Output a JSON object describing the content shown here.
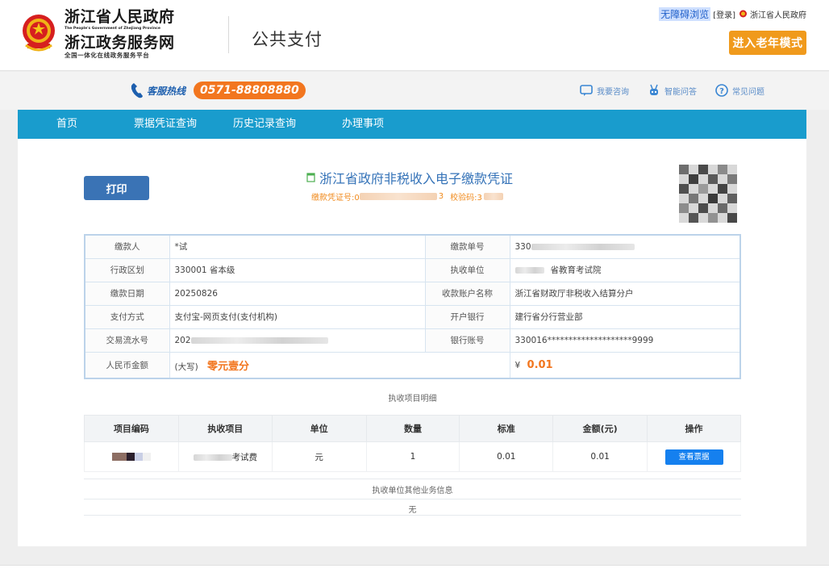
{
  "header": {
    "gov_name": "浙江省人民政府",
    "gov_name_en": "The People's Government of Zhejiang Province",
    "service_name": "浙江政务服务网",
    "service_subtitle": "全国一体化在线政务服务平台",
    "page_title": "公共支付",
    "accessibility_link": "无障碍浏览",
    "login_link": "[登录]",
    "gov_link": "浙江省人民政府",
    "elder_mode_button": "进入老年模式",
    "colors": {
      "elder_button": "#f09a1c",
      "accent_blue": "#199ccd"
    }
  },
  "service_bar": {
    "hotline_label": "客服热线",
    "hotline_number": "0571-88808880",
    "links": [
      {
        "label": "我要咨询",
        "icon": "chat-icon"
      },
      {
        "label": "智能问答",
        "icon": "robot-icon"
      },
      {
        "label": "常见问题",
        "icon": "question-icon"
      }
    ]
  },
  "nav": {
    "items": [
      "首页",
      "票据凭证查询",
      "历史记录查询",
      "办理事项"
    ]
  },
  "voucher": {
    "print_button": "打印",
    "title": "浙江省政府非税收入电子缴款凭证",
    "voucher_no_label": "缴款凭证号:0",
    "voucher_no_tail": "3",
    "check_code_label": "校验码:3"
  },
  "info": {
    "payer_label": "缴款人",
    "payer_value": "*试",
    "payment_no_label": "缴款单号",
    "payment_no_value": "330",
    "region_label": "行政区划",
    "region_value": "330001  省本级",
    "collector_label": "执收单位",
    "collector_value": "省教育考试院",
    "date_label": "缴款日期",
    "date_value": "20250826",
    "account_name_label": "收款账户名称",
    "account_name_value": "浙江省财政厅非税收入结算分户",
    "pay_method_label": "支付方式",
    "pay_method_value": "支付宝-网页支付(支付机构)",
    "bank_label": "开户银行",
    "bank_value": "建行省分行营业部",
    "serial_label": "交易流水号",
    "serial_value": "202",
    "bank_account_label": "银行账号",
    "bank_account_value": "330016********************9999",
    "amount_label": "人民币金额",
    "amount_cn_prefix": "(大写)",
    "amount_cn_value": "零元壹分",
    "amount_symbol": "¥",
    "amount_value": "0.01"
  },
  "detail": {
    "caption": "执收项目明细",
    "columns": [
      "项目编码",
      "执收项目",
      "单位",
      "数量",
      "标准",
      "金额(元)",
      "操作"
    ],
    "rows": [
      {
        "item": "考试费",
        "unit": "元",
        "quantity": "1",
        "standard": "0.01",
        "amount": "0.01",
        "action": "查看票据"
      }
    ]
  },
  "other_info": {
    "caption": "执收单位其他业务信息",
    "value": "无"
  }
}
